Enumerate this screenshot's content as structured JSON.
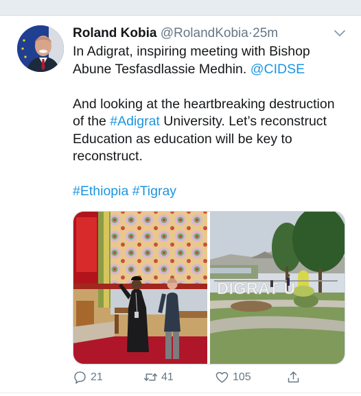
{
  "tweet": {
    "author_name": "Roland Kobia",
    "author_handle": "@RolandKobia",
    "separator": "·",
    "timestamp": "25m",
    "text_line1_prefix": "In Adigrat, inspiring meeting with Bishop Abune Tesfasdlassie Medhin. ",
    "mention": "@CIDSE",
    "text_p2_part1": "And looking at the heartbreaking destruction of the ",
    "hashtag_adigrat": "#Adigrat",
    "text_p2_part2": " University. Let’s reconstruct Education as education will be key to reconstruct.",
    "hashtag_ethiopia": "#Ethiopia",
    "hashtag_tigray": "#Tigray",
    "media_signage_text": "DIGRAT U"
  },
  "actions": {
    "reply_count": "21",
    "retweet_count": "41",
    "like_count": "105"
  },
  "icons": {
    "reply": "reply-icon",
    "retweet": "retweet-icon",
    "like": "heart-icon",
    "share": "share-icon",
    "caret": "chevron-down-icon"
  },
  "colors": {
    "link": "#1b95e0",
    "muted": "#657786",
    "text": "#14171a"
  }
}
